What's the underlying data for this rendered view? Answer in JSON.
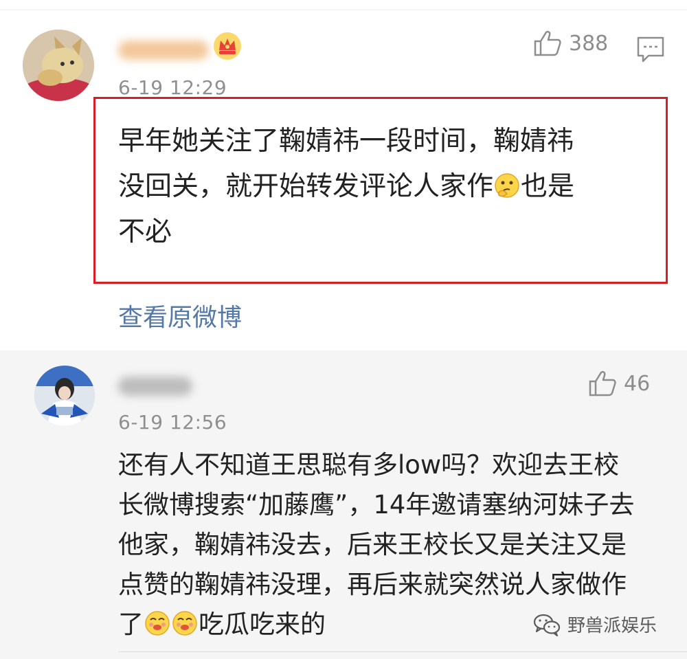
{
  "comments": [
    {
      "timestamp": "6-19 12:29",
      "likes": "388",
      "text_line1": "早年她关注了鞠婧祎一段时间，鞠婧祎",
      "text_line2a": "没回关，就开始转发评论人家作",
      "text_line2b": "也是",
      "text_line3": "不必",
      "view_original": "查看原微博",
      "emoji": "thinking-face"
    },
    {
      "timestamp": "6-19 12:56",
      "likes": "46",
      "text_line1": "还有人不知道王思聪有多low吗？欢迎去王校",
      "text_line2": "长微博搜索“加藤鹰”，14年邀请塞纳河妹子去",
      "text_line3": "他家，鞠婧祎没去，后来王校长又是关注又是",
      "text_line4": "点赞的鞠婧祎没理，再后来就突然说人家做作",
      "text_line5a": "了",
      "text_line5b": "吃瓜吃来的",
      "emoji": "drooling-face"
    }
  ],
  "watermark": "野兽派娱乐",
  "colors": {
    "highlight_border": "#d81e24",
    "link": "#5478a7",
    "timestamp": "#8f8f8f"
  }
}
